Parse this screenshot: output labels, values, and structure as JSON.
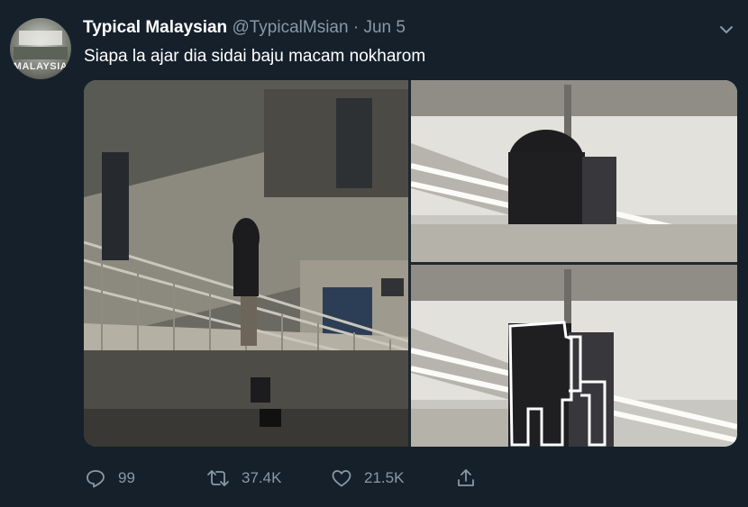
{
  "tweet": {
    "avatar_text": "MALAYSIA",
    "author_name": "Typical Malaysian",
    "author_handle": "@TypicalMsian",
    "separator": "·",
    "date": "Jun 5",
    "text": "Siapa la ajar dia sidai baju macam nokharom",
    "menu_icon": "chevron-down-icon",
    "media": [
      {
        "description_icon": "photo",
        "position": "left"
      },
      {
        "description_icon": "photo",
        "position": "top-right"
      },
      {
        "description_icon": "photo",
        "position": "bottom-right"
      }
    ]
  },
  "actions": {
    "reply": {
      "icon": "reply-icon",
      "count": "99"
    },
    "retweet": {
      "icon": "retweet-icon",
      "count": "37.4K"
    },
    "like": {
      "icon": "heart-icon",
      "count": "21.5K"
    },
    "share": {
      "icon": "share-icon"
    }
  },
  "colors": {
    "background": "#15202b",
    "secondary_text": "#8899a6",
    "primary_text": "#ffffff"
  }
}
